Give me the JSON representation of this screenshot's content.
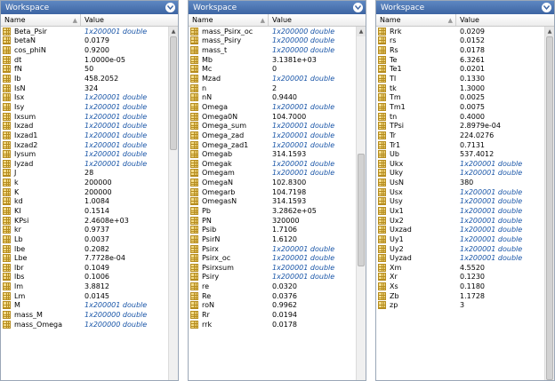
{
  "panels": [
    {
      "title": "Workspace",
      "col_name": "Name",
      "col_value": "Value",
      "rows": [
        {
          "name": "Beta_Psir",
          "value": "1x200001 double",
          "cls": true
        },
        {
          "name": "betaN",
          "value": "0.0179"
        },
        {
          "name": "cos_phiN",
          "value": "0.9200"
        },
        {
          "name": "dt",
          "value": "1.0000e-05"
        },
        {
          "name": "fN",
          "value": "50"
        },
        {
          "name": "Ib",
          "value": "458.2052"
        },
        {
          "name": "IsN",
          "value": "324"
        },
        {
          "name": "Isx",
          "value": "1x200001 double",
          "cls": true
        },
        {
          "name": "Isy",
          "value": "1x200001 double",
          "cls": true
        },
        {
          "name": "Ixsum",
          "value": "1x200001 double",
          "cls": true
        },
        {
          "name": "Ixzad",
          "value": "1x200001 double",
          "cls": true
        },
        {
          "name": "Ixzad1",
          "value": "1x200001 double",
          "cls": true
        },
        {
          "name": "Ixzad2",
          "value": "1x200001 double",
          "cls": true
        },
        {
          "name": "Iysum",
          "value": "1x200001 double",
          "cls": true
        },
        {
          "name": "Iyzad",
          "value": "1x200001 double",
          "cls": true
        },
        {
          "name": "J",
          "value": "28"
        },
        {
          "name": "k",
          "value": "200000"
        },
        {
          "name": "K",
          "value": "200000"
        },
        {
          "name": "kd",
          "value": "1.0084"
        },
        {
          "name": "KI",
          "value": "0.1514"
        },
        {
          "name": "KPsi",
          "value": "2.4608e+03"
        },
        {
          "name": "kr",
          "value": "0.9737"
        },
        {
          "name": "Lb",
          "value": "0.0037"
        },
        {
          "name": "lbe",
          "value": "0.2082"
        },
        {
          "name": "Lbe",
          "value": "7.7728e-04"
        },
        {
          "name": "lbr",
          "value": "0.1049"
        },
        {
          "name": "lbs",
          "value": "0.1006"
        },
        {
          "name": "lm",
          "value": "3.8812"
        },
        {
          "name": "Lm",
          "value": "0.0145"
        },
        {
          "name": "M",
          "value": "1x200001 double",
          "cls": true
        },
        {
          "name": "mass_M",
          "value": "1x200000 double",
          "cls": true
        },
        {
          "name": "mass_Omega",
          "value": "1x200000 double",
          "cls": true
        }
      ],
      "scroll": {
        "top": 0.0,
        "size": 0.33
      }
    },
    {
      "title": "Workspace",
      "col_name": "Name",
      "col_value": "Value",
      "rows": [
        {
          "name": "mass_Psirx_oc",
          "value": "1x200000 double",
          "cls": true
        },
        {
          "name": "mass_Psiry",
          "value": "1x200000 double",
          "cls": true
        },
        {
          "name": "mass_t",
          "value": "1x200000 double",
          "cls": true
        },
        {
          "name": "Mb",
          "value": "3.1381e+03"
        },
        {
          "name": "Mc",
          "value": "0"
        },
        {
          "name": "Mzad",
          "value": "1x200001 double",
          "cls": true
        },
        {
          "name": "n",
          "value": "2"
        },
        {
          "name": "nN",
          "value": "0.9440"
        },
        {
          "name": "Omega",
          "value": "1x200001 double",
          "cls": true
        },
        {
          "name": "Omega0N",
          "value": "104.7000"
        },
        {
          "name": "Omega_sum",
          "value": "1x200001 double",
          "cls": true
        },
        {
          "name": "Omega_zad",
          "value": "1x200001 double",
          "cls": true
        },
        {
          "name": "Omega_zad1",
          "value": "1x200001 double",
          "cls": true
        },
        {
          "name": "Omegab",
          "value": "314.1593"
        },
        {
          "name": "Omegak",
          "value": "1x200001 double",
          "cls": true
        },
        {
          "name": "Omegam",
          "value": "1x200001 double",
          "cls": true
        },
        {
          "name": "OmegaN",
          "value": "102.8300"
        },
        {
          "name": "Omegarb",
          "value": "104.7198"
        },
        {
          "name": "OmegasN",
          "value": "314.1593"
        },
        {
          "name": "Pb",
          "value": "3.2862e+05"
        },
        {
          "name": "PN",
          "value": "320000"
        },
        {
          "name": "Psib",
          "value": "1.7106"
        },
        {
          "name": "PsirN",
          "value": "1.6120"
        },
        {
          "name": "Psirx",
          "value": "1x200001 double",
          "cls": true
        },
        {
          "name": "Psirx_oc",
          "value": "1x200001 double",
          "cls": true
        },
        {
          "name": "Psirxsum",
          "value": "1x200001 double",
          "cls": true
        },
        {
          "name": "Psiry",
          "value": "1x200001 double",
          "cls": true
        },
        {
          "name": "re",
          "value": "0.0320"
        },
        {
          "name": "Re",
          "value": "0.0376"
        },
        {
          "name": "roN",
          "value": "0.9962"
        },
        {
          "name": "Rr",
          "value": "0.0194"
        },
        {
          "name": "rrk",
          "value": "0.0178"
        }
      ],
      "scroll": {
        "top": 0.34,
        "size": 0.33
      }
    },
    {
      "title": "Workspace",
      "col_name": "Name",
      "col_value": "Value",
      "rows": [
        {
          "name": "Rrk",
          "value": "0.0209"
        },
        {
          "name": "rs",
          "value": "0.0152"
        },
        {
          "name": "Rs",
          "value": "0.0178"
        },
        {
          "name": "Te",
          "value": "6.3261"
        },
        {
          "name": "Te1",
          "value": "0.0201"
        },
        {
          "name": "TI",
          "value": "0.1330"
        },
        {
          "name": "tk",
          "value": "1.3000"
        },
        {
          "name": "Tm",
          "value": "0.0025"
        },
        {
          "name": "Tm1",
          "value": "0.0075"
        },
        {
          "name": "tn",
          "value": "0.4000"
        },
        {
          "name": "TPsi",
          "value": "2.8979e-04"
        },
        {
          "name": "Tr",
          "value": "224.0276"
        },
        {
          "name": "Tr1",
          "value": "0.7131"
        },
        {
          "name": "Ub",
          "value": "537.4012"
        },
        {
          "name": "Ukx",
          "value": "1x200001 double",
          "cls": true
        },
        {
          "name": "Uky",
          "value": "1x200001 double",
          "cls": true
        },
        {
          "name": "UsN",
          "value": "380"
        },
        {
          "name": "Usx",
          "value": "1x200001 double",
          "cls": true
        },
        {
          "name": "Usy",
          "value": "1x200001 double",
          "cls": true
        },
        {
          "name": "Ux1",
          "value": "1x200001 double",
          "cls": true
        },
        {
          "name": "Ux2",
          "value": "1x200001 double",
          "cls": true
        },
        {
          "name": "Uxzad",
          "value": "1x200001 double",
          "cls": true
        },
        {
          "name": "Uy1",
          "value": "1x200001 double",
          "cls": true
        },
        {
          "name": "Uy2",
          "value": "1x200001 double",
          "cls": true
        },
        {
          "name": "Uyzad",
          "value": "1x200001 double",
          "cls": true
        },
        {
          "name": "Xm",
          "value": "4.5520"
        },
        {
          "name": "Xr",
          "value": "0.1230"
        },
        {
          "name": "Xs",
          "value": "0.1180"
        },
        {
          "name": "Zb",
          "value": "1.1728"
        },
        {
          "name": "zp",
          "value": "3"
        }
      ],
      "scroll": {
        "top": 0.0,
        "size": 1.0
      }
    }
  ]
}
